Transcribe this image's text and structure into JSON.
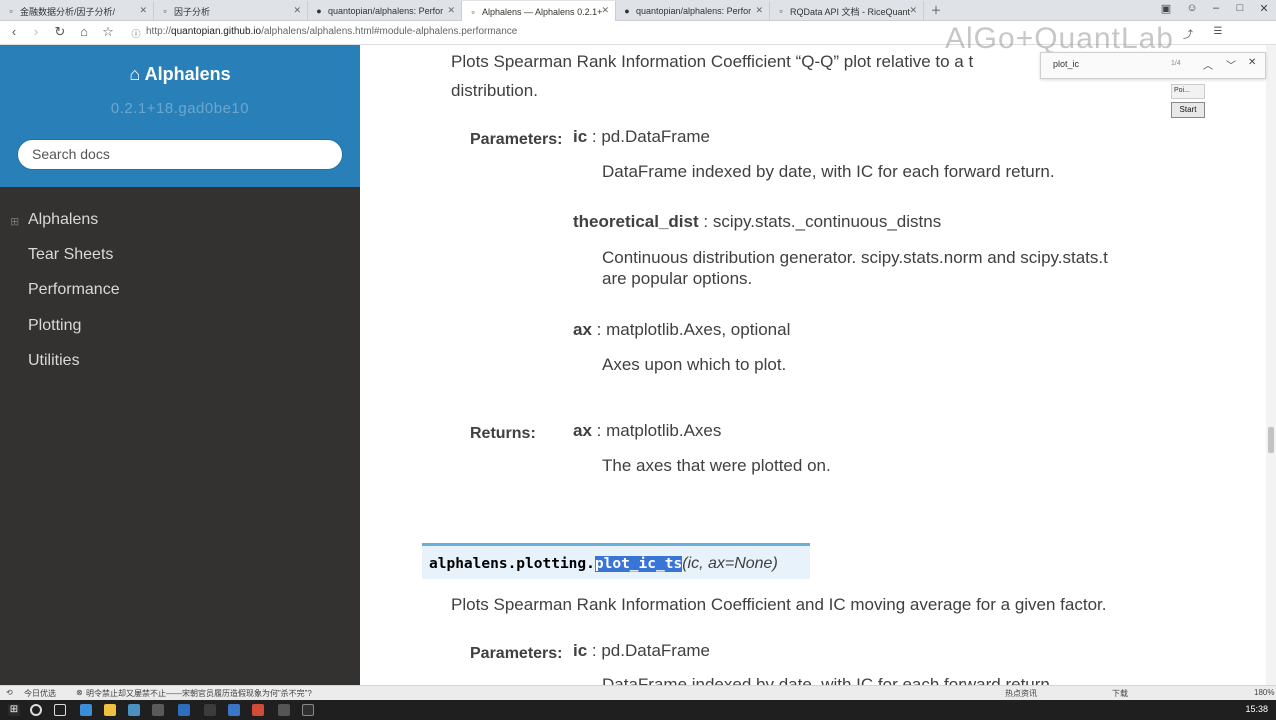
{
  "tabs": [
    {
      "label": "金融数据分析/因子分析/",
      "active": false
    },
    {
      "label": "因子分析",
      "active": false
    },
    {
      "label": "quantopian/alphalens: Perfor",
      "active": false
    },
    {
      "label": "Alphalens — Alphalens 0.2.1+",
      "active": true
    },
    {
      "label": "quantopian/alphalens: Perfor",
      "active": false
    },
    {
      "label": "RQData API 文档 - RiceQuant",
      "active": false
    }
  ],
  "address": {
    "prefix": "http://",
    "host": "quantopian.github.io",
    "path": "/alphalens/alphalens.html#module-alphalens.performance"
  },
  "sidebar": {
    "brand": "Alphalens",
    "version": "0.2.1+18.gad0be10",
    "search_placeholder": "Search docs",
    "items": [
      {
        "label": "Alphalens"
      },
      {
        "label": "Tear Sheets"
      },
      {
        "label": "Performance"
      },
      {
        "label": "Plotting"
      },
      {
        "label": "Utilities"
      }
    ]
  },
  "content": {
    "intro_line1": "Plots Spearman Rank Information Coefficient “Q-Q” plot relative to a t",
    "intro_line2": "distribution.",
    "parameters_label": "Parameters:",
    "returns_label": "Returns:",
    "params": [
      {
        "name": "ic",
        "type": " : pd.DataFrame",
        "desc": [
          "DataFrame indexed by date, with IC for each forward return."
        ]
      },
      {
        "name": "theoretical_dist",
        "type": " : scipy.stats._continuous_distns",
        "desc": [
          "Continuous distribution generator. scipy.stats.norm and scipy.stats.t",
          "are popular options."
        ]
      },
      {
        "name": "ax",
        "type": " : matplotlib.Axes, optional",
        "desc": [
          "Axes upon which to plot."
        ]
      }
    ],
    "returns": {
      "name": "ax",
      "type": " : matplotlib.Axes",
      "desc": "The axes that were plotted on."
    },
    "signature": {
      "module": "alphalens.plotting.",
      "func": "plot_ic_ts",
      "args": "(ic, ax=None)"
    },
    "next_desc": "Plots Spearman Rank Information Coefficient and IC moving average for a given factor.",
    "next_param": {
      "name": "ic",
      "type": " : pd.DataFrame",
      "desc": "DataFrame indexed by date, with IC for each forward return."
    }
  },
  "findbar": {
    "query": "plot_ic",
    "count": "1/4"
  },
  "overlay": {
    "watermark": "AlGo+QuantLab",
    "mini_label": "Poi...",
    "start_button": "Start"
  },
  "statusbar": {
    "left1": "今日优选",
    "left2": "明令禁止却又屡禁不止——宋朝官员履历造假现象为何”杀不完”?",
    "news": "热点资讯",
    "download": "下载",
    "zoom": "180%"
  },
  "taskbar": {
    "clock": "15:38"
  },
  "colors": {
    "brand_blue": "#2980b9",
    "sidebar_dark": "#343131",
    "highlight": "#3875d7",
    "sig_bg": "#e7f2fa"
  }
}
